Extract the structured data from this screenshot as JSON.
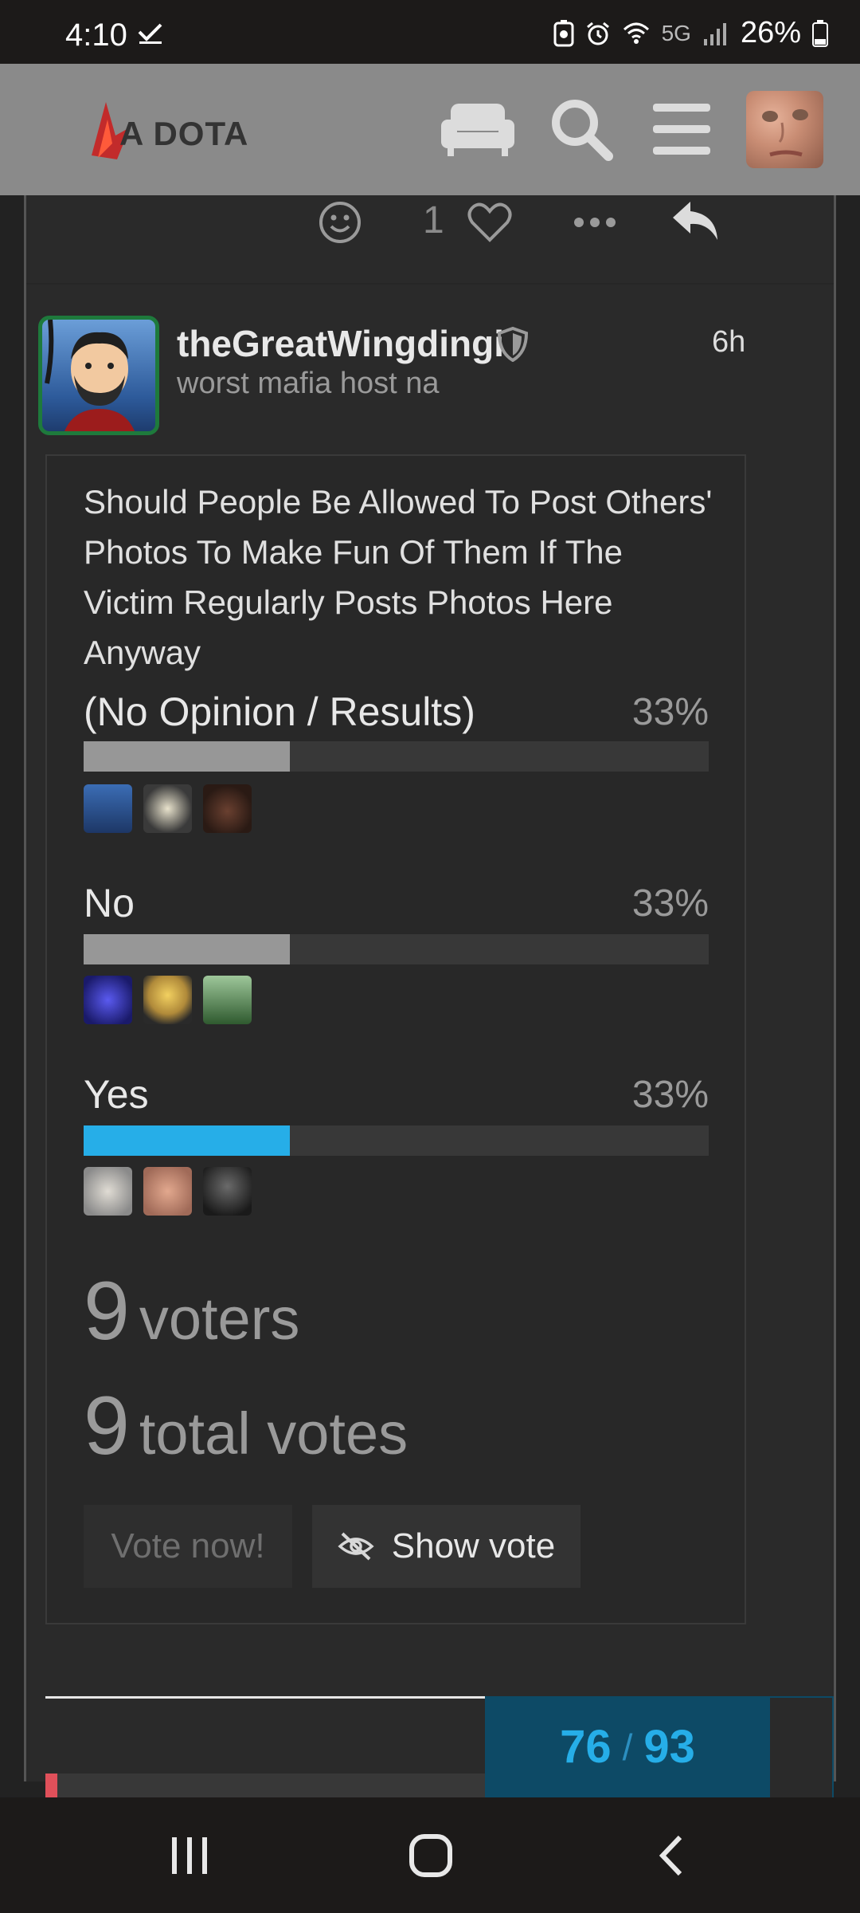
{
  "status_bar": {
    "time": "4:10",
    "network": "5G",
    "battery": "26%"
  },
  "header": {
    "logo_text": "A DOTA"
  },
  "post_actions": {
    "like_count": "1"
  },
  "post": {
    "username": "theGreatWingdingi",
    "user_title": "worst mafia host na",
    "time": "6h"
  },
  "poll": {
    "question": "Should People Be Allowed To Post Others' Photos To Make Fun Of Them If The Victim Regularly Posts Photos Here Anyway",
    "options": [
      {
        "label": "(No Opinion / Results)",
        "percent": "33%",
        "fraction": 0.33,
        "chosen": false
      },
      {
        "label": "No",
        "percent": "33%",
        "fraction": 0.33,
        "chosen": false
      },
      {
        "label": "Yes",
        "percent": "33%",
        "fraction": 0.33,
        "chosen": true
      }
    ],
    "voters_count": "9",
    "voters_label": "voters",
    "votes_count": "9",
    "votes_label": "total votes",
    "vote_button": "Vote now!",
    "show_vote_button": "Show vote"
  },
  "progress": {
    "current": "76",
    "total": "93",
    "separator": "/"
  },
  "colors": {
    "accent": "#26aee8",
    "bar": "#979797",
    "avatar_border": "#1e7a3c"
  }
}
